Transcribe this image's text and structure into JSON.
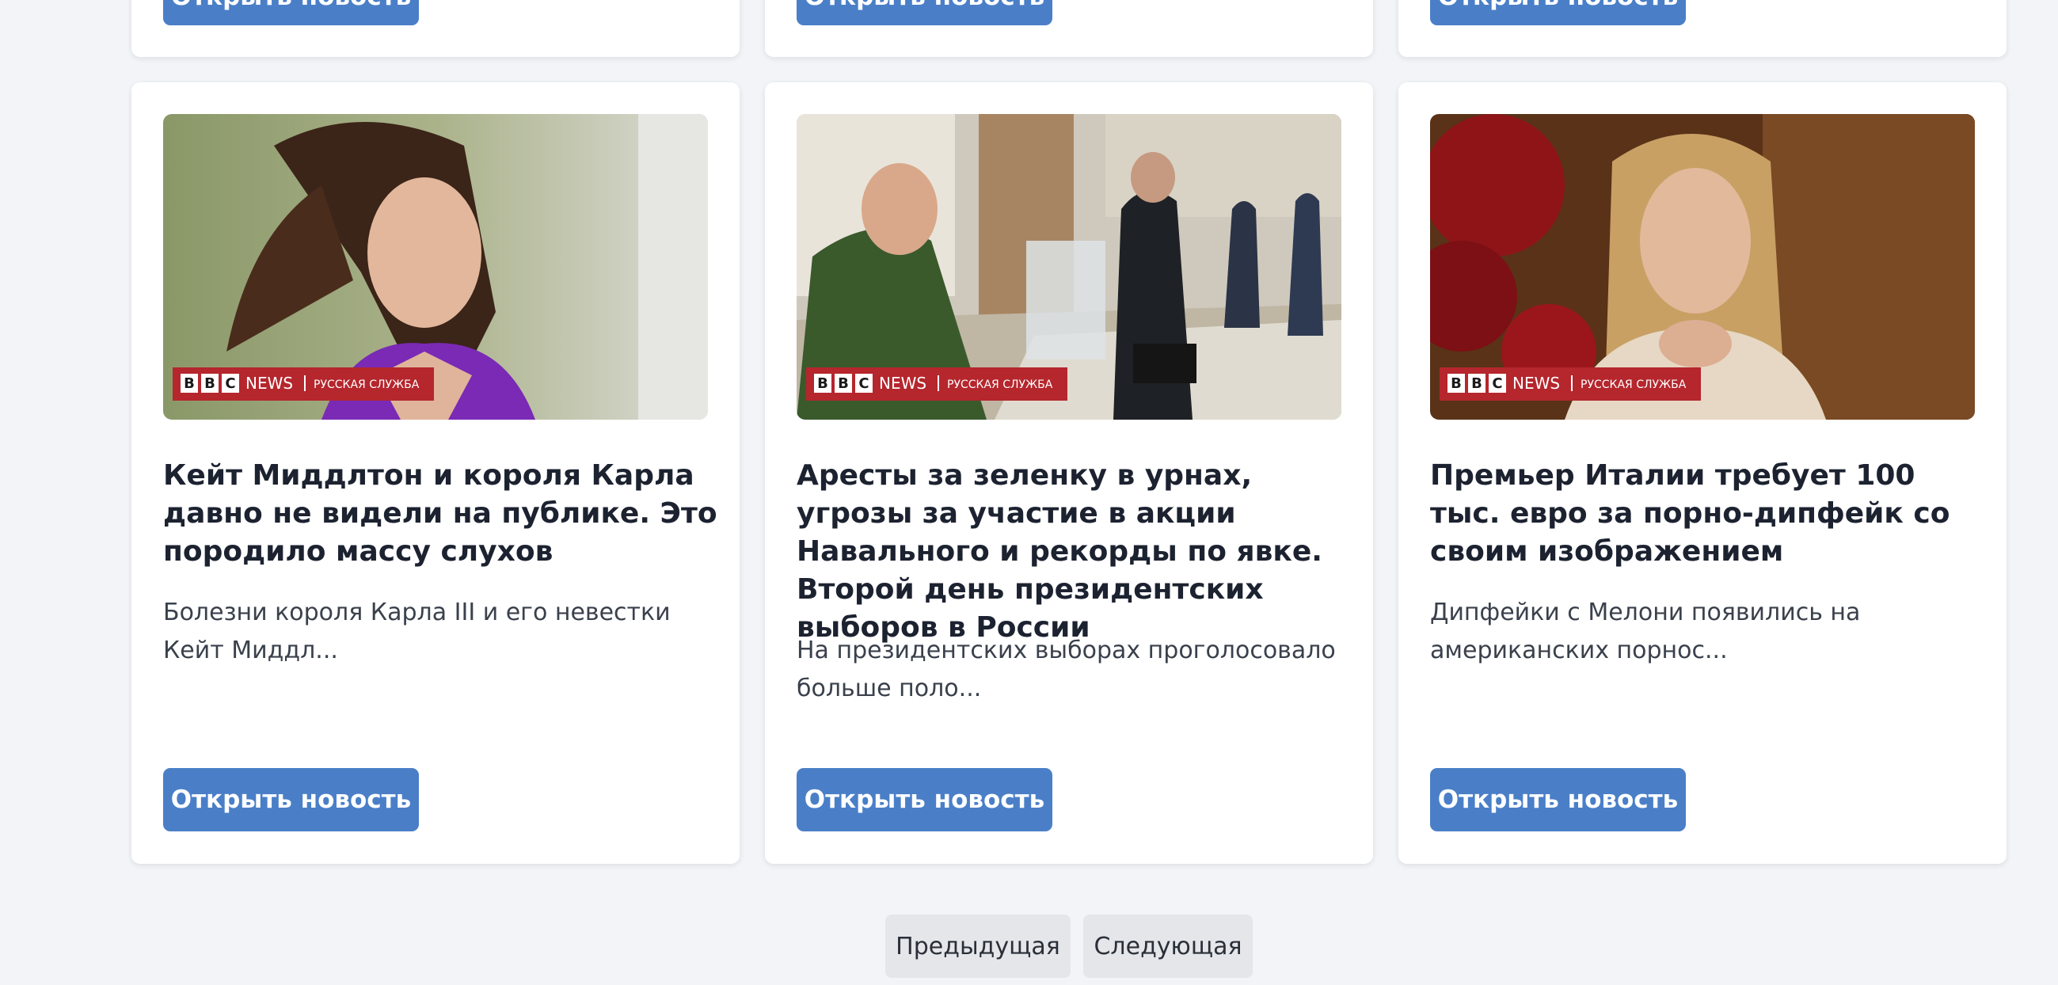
{
  "top_cards": [
    {
      "button_label": "Открыть новость"
    },
    {
      "button_label": "Открыть новость"
    },
    {
      "button_label": "Открыть новость"
    }
  ],
  "articles": [
    {
      "image_label": "BBC NEWS | РУССКАЯ СЛУЖБА",
      "title": "Кейт Миддлтон и короля Карла давно не видели на публике. Это породило массу слухов",
      "description": "Болезни короля Карла III и его невестки Кейт Миддл...",
      "button_label": "Открыть новость"
    },
    {
      "image_label": "BBC NEWS | РУССКАЯ СЛУЖБА",
      "title": "Аресты за зеленку в урнах, угрозы за участие в акции Навального и рекорды по явке. Второй день президентских выборов в России",
      "description": "На президентских выборах проголосовало больше поло...",
      "button_label": "Открыть новость"
    },
    {
      "image_label": "BBC NEWS | РУССКАЯ СЛУЖБА",
      "title": "Премьер Италии требует 100 тыс. евро за порно-дипфейк со своим изображением",
      "description": "Дипфейки с Мелони появились на американских порнос...",
      "button_label": "Открыть новость"
    }
  ],
  "pagination": {
    "prev_label": "Предыдущая",
    "next_label": "Следующая"
  },
  "colors": {
    "accent": "#4a7fc8",
    "background": "#f2f4f7",
    "bbc_banner": "#b5262d"
  },
  "bbc_logo": {
    "letters": [
      "B",
      "B",
      "C"
    ],
    "news_word": "NEWS",
    "service": "РУССКАЯ СЛУЖБА"
  }
}
